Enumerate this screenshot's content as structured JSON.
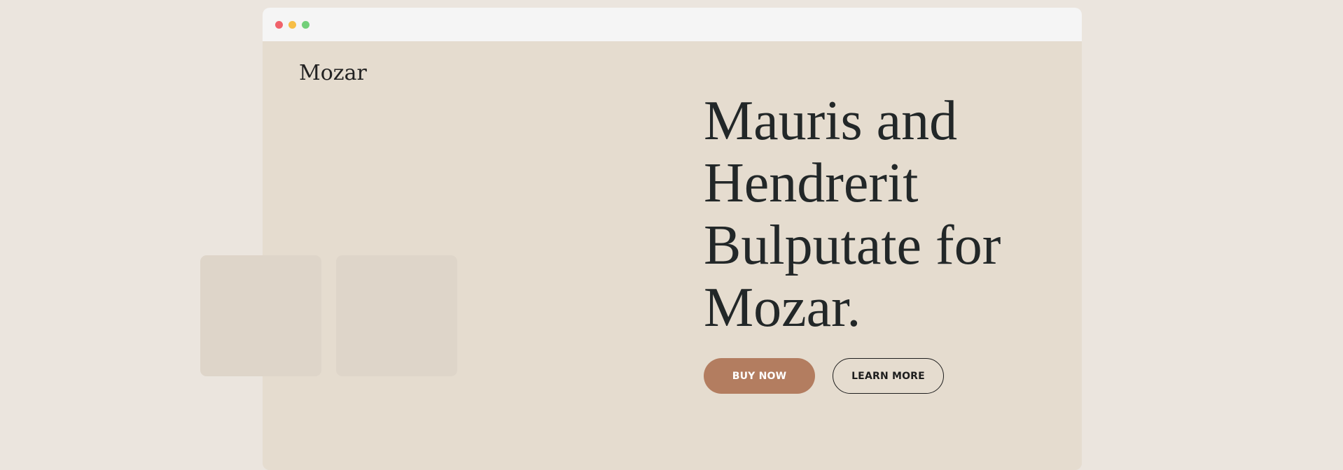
{
  "window": {
    "controls": [
      "close",
      "minimize",
      "maximize"
    ]
  },
  "site": {
    "logo": "Mozar"
  },
  "hero": {
    "title_lines": [
      "Mauris and",
      "Hendrerit",
      "Bulputate for",
      "Mozar."
    ],
    "buttons": {
      "buy": "BUY NOW",
      "learn": "LEARN MORE"
    }
  },
  "colors": {
    "page_background": "#ebe5de",
    "hero_background": "#e5dccf",
    "titlebar": "#f5f5f5",
    "accent_button": "#b37d60",
    "placeholder_tile": "#ded5c9",
    "text": "#222728"
  }
}
